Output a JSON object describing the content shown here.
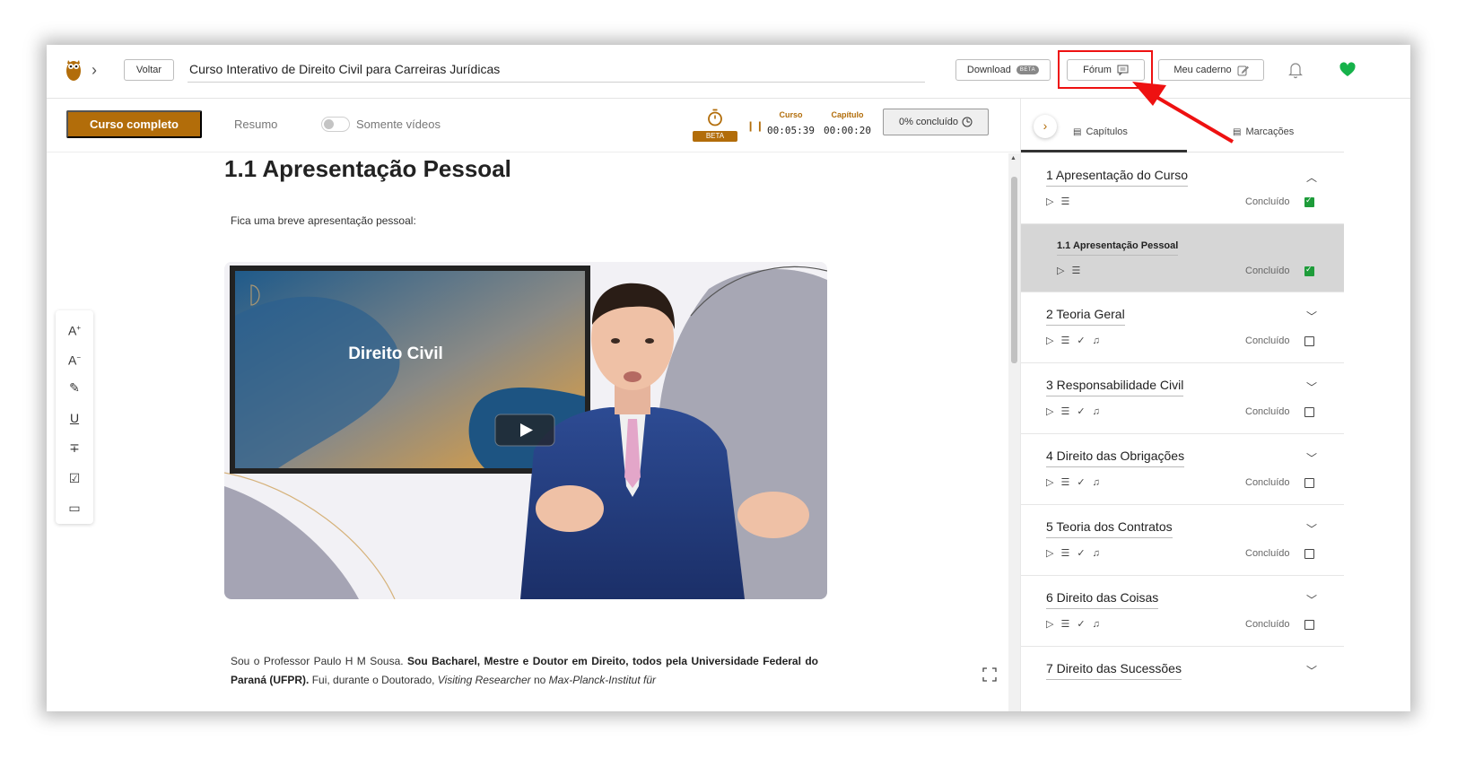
{
  "topbar": {
    "back_label": "Voltar",
    "course_title": "Curso Interativo de Direito Civil para Carreiras Jurídicas",
    "download_label": "Download",
    "download_badge": "BETA",
    "forum_label": "Fórum",
    "notebook_label": "Meu caderno"
  },
  "subbar": {
    "full_course_label": "Curso completo",
    "summary_label": "Resumo",
    "only_videos_label": "Somente vídeos",
    "beta_badge": "BETA",
    "course_time_label": "Curso",
    "course_time": "00:05:39",
    "chapter_time_label": "Capítulo",
    "chapter_time": "00:00:20",
    "progress_label": "0% concluído"
  },
  "lesson": {
    "title": "1.1 Apresentação Pessoal",
    "intro": "Fica uma breve apresentação pessoal:",
    "video_slide_title": "Direito Civil",
    "para_plain_1": "Sou o Professor Paulo H M Sousa. ",
    "para_bold": "Sou Bacharel, Mestre e Doutor em Direito, todos pela Universidade Federal do Paraná (UFPR).",
    "para_plain_2": " Fui, durante o Doutorado, ",
    "para_italic_1": "Visiting Researcher",
    "para_plain_3": " no ",
    "para_italic_2": "Max-Planck-Institut für"
  },
  "panel": {
    "tab_chapters": "Capítulos",
    "tab_marks": "Marcações",
    "status_label": "Concluído",
    "chapters": [
      {
        "title": "1 Apresentação do Curso",
        "done": true
      },
      {
        "title": "1.1 Apresentação Pessoal",
        "done": true
      },
      {
        "title": "2 Teoria Geral",
        "done": false
      },
      {
        "title": "3 Responsabilidade Civil",
        "done": false
      },
      {
        "title": "4 Direito das Obrigações",
        "done": false
      },
      {
        "title": "5 Teoria dos Contratos",
        "done": false
      },
      {
        "title": "6 Direito das Coisas",
        "done": false
      },
      {
        "title": "7 Direito das Sucessões",
        "done": false
      }
    ]
  },
  "colors": {
    "accent": "#b26d0a",
    "done_green": "#1e9c3a",
    "highlight_red": "#ee1111",
    "heart_green": "#16b24a"
  },
  "icons": [
    "owl-logo-icon",
    "chevron-right-icon",
    "comment-icon",
    "edit-icon",
    "bell-icon",
    "heart-icon",
    "stopwatch-icon",
    "pause-icon",
    "clock-icon",
    "play-icon",
    "text-icon",
    "check-icon",
    "music-icon",
    "chevron-up-icon",
    "chevron-down-icon",
    "expand-icon"
  ]
}
